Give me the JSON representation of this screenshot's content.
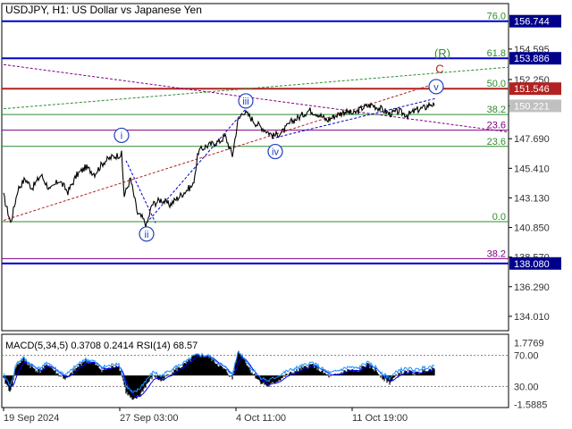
{
  "header": {
    "symbol": "USDJPY",
    "timeframe": "H1",
    "description": "US Dollar vs Japanese Yen",
    "separator": ", ",
    "separator2": ":  "
  },
  "colors": {
    "background": "#ffffff",
    "frame": "#000000",
    "grid_text": "#333333",
    "price_line": "#000000",
    "blue_level": "#0000cd",
    "red_level": "#b22222",
    "green_fib": "#2e8b2e",
    "purple_fib": "#800080",
    "wave_label": "#1f3fbf",
    "wave_fill": "#ffffff",
    "current_price_bg": "#c0c0c0",
    "macd_hist": "#000000",
    "signal_line": "#0000ff",
    "rsi_line": "#1e90ff",
    "label_bg_blue": "#00008b",
    "label_bg_red": "#b22222"
  },
  "chart_data": [
    {
      "type": "line",
      "name": "price",
      "y_axis_ticks": [
        "154.595",
        "152.250",
        "150.221",
        "147.690",
        "145.410",
        "143.130",
        "140.850",
        "138.570",
        "136.290",
        "134.010"
      ],
      "y_axis_values": [
        154.595,
        152.25,
        150.221,
        147.69,
        145.41,
        143.13,
        140.85,
        138.57,
        136.29,
        134.01
      ],
      "ylim": [
        132.9,
        158.1
      ],
      "x_axis_ticks": [
        "19 Sep 2024",
        "27 Sep 03:00",
        "4 Oct 11:00",
        "11 Oct 19:00"
      ],
      "x_tick_index": [
        0,
        130,
        260,
        390
      ],
      "x_range": [
        0,
        482
      ],
      "anchors": [
        [
          0,
          143.3
        ],
        [
          8,
          141.2
        ],
        [
          16,
          143.8
        ],
        [
          24,
          144.6
        ],
        [
          32,
          143.9
        ],
        [
          42,
          144.9
        ],
        [
          52,
          143.7
        ],
        [
          62,
          144.5
        ],
        [
          72,
          143.6
        ],
        [
          82,
          144.9
        ],
        [
          92,
          145.5
        ],
        [
          102,
          145.0
        ],
        [
          112,
          145.9
        ],
        [
          122,
          146.3
        ],
        [
          132,
          146.5
        ],
        [
          135,
          143.3
        ],
        [
          142,
          144.6
        ],
        [
          150,
          141.9
        ],
        [
          155,
          141.6
        ],
        [
          160,
          141.0
        ],
        [
          166,
          142.6
        ],
        [
          176,
          143.0
        ],
        [
          186,
          142.6
        ],
        [
          196,
          143.2
        ],
        [
          206,
          143.8
        ],
        [
          212,
          144.1
        ],
        [
          218,
          146.7
        ],
        [
          226,
          147.1
        ],
        [
          234,
          147.3
        ],
        [
          242,
          147.5
        ],
        [
          248,
          147.9
        ],
        [
          256,
          146.4
        ],
        [
          262,
          149.0
        ],
        [
          268,
          149.8
        ],
        [
          274,
          149.5
        ],
        [
          282,
          148.9
        ],
        [
          292,
          148.4
        ],
        [
          302,
          147.9
        ],
        [
          312,
          148.2
        ],
        [
          322,
          149.0
        ],
        [
          332,
          149.4
        ],
        [
          342,
          149.9
        ],
        [
          352,
          149.6
        ],
        [
          362,
          149.1
        ],
        [
          372,
          149.5
        ],
        [
          382,
          149.8
        ],
        [
          392,
          149.6
        ],
        [
          402,
          150.1
        ],
        [
          412,
          150.3
        ],
        [
          422,
          150.0
        ],
        [
          432,
          149.6
        ],
        [
          442,
          149.8
        ],
        [
          452,
          149.5
        ],
        [
          462,
          149.9
        ],
        [
          472,
          150.1
        ],
        [
          478,
          150.4
        ],
        [
          482,
          150.22
        ]
      ],
      "current_price": "150.221",
      "current_price_value": 150.221,
      "levels": [
        {
          "label": "156.744",
          "value": 156.744,
          "kind": "blue"
        },
        {
          "label": "153.886",
          "value": 153.886,
          "kind": "blue"
        },
        {
          "label": "151.546",
          "value": 151.546,
          "kind": "red"
        },
        {
          "label": "138.080",
          "value": 138.08,
          "kind": "blue"
        }
      ],
      "fib_levels": [
        {
          "label": "76.0",
          "value": 156.744,
          "kind": "green"
        },
        {
          "label": "61.8",
          "value": 153.886,
          "kind": "green"
        },
        {
          "label": "50.0",
          "value": 151.546,
          "kind": "green"
        },
        {
          "label": "38.2",
          "value": 149.55,
          "kind": "green"
        },
        {
          "label": "23.6",
          "value": 148.35,
          "kind": "purple"
        },
        {
          "label": "23.6",
          "value": 147.1,
          "kind": "green"
        },
        {
          "label": "0.0",
          "value": 141.3,
          "kind": "green"
        },
        {
          "label": "38.2",
          "value": 138.45,
          "kind": "purple"
        }
      ],
      "wave_labels": [
        {
          "text": "i",
          "x": 132,
          "y": 147.95,
          "style": "circle"
        },
        {
          "text": "ii",
          "x": 160,
          "y": 140.35,
          "style": "circle"
        },
        {
          "text": "iii",
          "x": 271,
          "y": 150.6,
          "style": "circle"
        },
        {
          "text": "iv",
          "x": 304,
          "y": 146.7,
          "style": "circle"
        },
        {
          "text": "v",
          "x": 484,
          "y": 151.7,
          "style": "circle"
        },
        {
          "text": "C",
          "x": 488,
          "y": 153.1,
          "style": "plain"
        },
        {
          "text": "(R)",
          "x": 491,
          "y": 154.3,
          "style": "plain"
        }
      ],
      "trend_lines": [
        {
          "from": [
            0,
            153.4
          ],
          "to": [
            570,
            148.2
          ],
          "kind": "purple"
        },
        {
          "from": [
            0,
            150.0
          ],
          "to": [
            570,
            153.2
          ],
          "kind": "green"
        },
        {
          "from": [
            0,
            141.4
          ],
          "to": [
            486,
            152.0
          ],
          "kind": "red"
        },
        {
          "from": [
            137,
            146.0
          ],
          "to": [
            170,
            141.2
          ],
          "kind": "blue"
        },
        {
          "from": [
            160,
            141.2
          ],
          "to": [
            270,
            149.9
          ],
          "kind": "blue"
        },
        {
          "from": [
            300,
            147.7
          ],
          "to": [
            484,
            150.8
          ],
          "kind": "blue"
        }
      ]
    },
    {
      "type": "bar",
      "name": "indicator",
      "label": "MACD(5,34,5) 0.3708 0.2414 RSI(14) 68.57",
      "y_axis_ticks": [
        "1.7769",
        "70.00",
        "30.00",
        "-1.5885"
      ],
      "reference_values": [
        1.7769,
        70.0,
        30.0,
        -1.5885
      ],
      "ylim": [
        -1.75,
        2.25
      ],
      "anchors": [
        [
          0,
          -0.2
        ],
        [
          8,
          -0.9
        ],
        [
          14,
          0.5
        ],
        [
          22,
          0.9
        ],
        [
          30,
          0.5
        ],
        [
          40,
          0.2
        ],
        [
          50,
          0.6
        ],
        [
          60,
          0.1
        ],
        [
          70,
          -0.2
        ],
        [
          80,
          0.3
        ],
        [
          90,
          0.8
        ],
        [
          100,
          0.7
        ],
        [
          110,
          0.3
        ],
        [
          120,
          0.4
        ],
        [
          128,
          0.6
        ],
        [
          132,
          0.1
        ],
        [
          137,
          -0.9
        ],
        [
          145,
          -1.4
        ],
        [
          152,
          -1.1
        ],
        [
          160,
          -0.5
        ],
        [
          168,
          0.0
        ],
        [
          176,
          -0.3
        ],
        [
          186,
          0.1
        ],
        [
          196,
          0.4
        ],
        [
          206,
          0.7
        ],
        [
          212,
          1.0
        ],
        [
          220,
          1.1
        ],
        [
          230,
          1.0
        ],
        [
          240,
          0.6
        ],
        [
          250,
          0.2
        ],
        [
          256,
          -0.2
        ],
        [
          262,
          1.3
        ],
        [
          268,
          1.0
        ],
        [
          276,
          0.3
        ],
        [
          286,
          -0.3
        ],
        [
          296,
          -0.6
        ],
        [
          306,
          -0.3
        ],
        [
          316,
          0.0
        ],
        [
          326,
          0.2
        ],
        [
          336,
          0.4
        ],
        [
          346,
          0.6
        ],
        [
          356,
          0.2
        ],
        [
          366,
          -0.1
        ],
        [
          376,
          0.1
        ],
        [
          386,
          0.3
        ],
        [
          396,
          0.2
        ],
        [
          406,
          0.6
        ],
        [
          416,
          0.3
        ],
        [
          426,
          -0.2
        ],
        [
          432,
          -0.4
        ],
        [
          442,
          0.1
        ],
        [
          452,
          0.2
        ],
        [
          462,
          0.1
        ],
        [
          472,
          0.3
        ],
        [
          482,
          0.37
        ]
      ]
    }
  ]
}
